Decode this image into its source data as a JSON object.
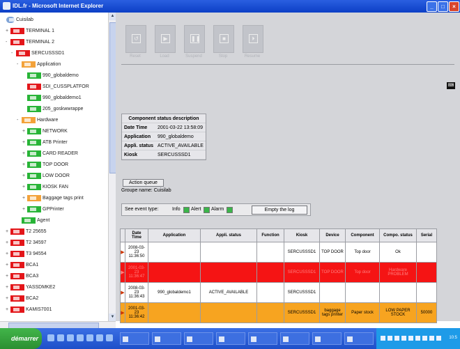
{
  "window": {
    "title": "IDL.fr - Microsoft Internet Explorer"
  },
  "tree": {
    "nodes": [
      {
        "label": "Cuisilab",
        "color": "root",
        "expander": ""
      },
      {
        "label": "TERMINAL 1",
        "color": "red",
        "expander": "+"
      },
      {
        "label": "TERMINAL 2",
        "color": "red",
        "expander": "-"
      },
      {
        "label": "SERCUSSSD1",
        "color": "red",
        "expander": "-"
      },
      {
        "label": "Application",
        "color": "orange",
        "expander": "-"
      },
      {
        "label": "990_globaldemo",
        "color": "green",
        "expander": ""
      },
      {
        "label": "SDI_CUSSPLATFOR",
        "color": "red",
        "expander": ""
      },
      {
        "label": "990_globaldemo1",
        "color": "green",
        "expander": ""
      },
      {
        "label": "205_goskwwrappe",
        "color": "green",
        "expander": ""
      },
      {
        "label": "Hardware",
        "color": "orange",
        "expander": "-"
      },
      {
        "label": "NETWORK",
        "color": "green",
        "expander": "+"
      },
      {
        "label": "ATB Printer",
        "color": "green",
        "expander": "+"
      },
      {
        "label": "CARD READER",
        "color": "green",
        "expander": "+"
      },
      {
        "label": "TOP DOOR",
        "color": "green",
        "expander": "+"
      },
      {
        "label": "LOW DOOR",
        "color": "green",
        "expander": "+"
      },
      {
        "label": "KIOSK FAN",
        "color": "green",
        "expander": "+"
      },
      {
        "label": "Baggage tags print",
        "color": "orange",
        "expander": "+"
      },
      {
        "label": "GPPrinter",
        "color": "green",
        "expander": "+"
      },
      {
        "label": "Agent",
        "color": "green",
        "expander": ""
      },
      {
        "label": "T2 25655",
        "color": "red",
        "expander": "+"
      },
      {
        "label": "T2 34597",
        "color": "red",
        "expander": "+"
      },
      {
        "label": "T3 94554",
        "color": "red",
        "expander": "+"
      },
      {
        "label": "BCA1",
        "color": "red",
        "expander": "+"
      },
      {
        "label": "BCA3",
        "color": "red",
        "expander": "+"
      },
      {
        "label": "YASSDMKE2",
        "color": "red",
        "expander": "+"
      },
      {
        "label": "BCA2",
        "color": "red",
        "expander": "+"
      },
      {
        "label": "KAMIS7001",
        "color": "red",
        "expander": "+"
      }
    ]
  },
  "toolbar": {
    "buttons": [
      {
        "label": "Reset",
        "icon": "reset-icon"
      },
      {
        "label": "Load",
        "icon": "play-icon"
      },
      {
        "label": "Suspend",
        "icon": "pause-icon"
      },
      {
        "label": "Stop",
        "icon": "stop-icon"
      },
      {
        "label": "Resume",
        "icon": "resume-icon"
      }
    ]
  },
  "component": {
    "heading": "Component status description",
    "rows": [
      {
        "key": "Date Time",
        "value": "2001-03-22 13:58:09"
      },
      {
        "key": "Application",
        "value": "990_globaldemo"
      },
      {
        "key": "Appli. status",
        "value": "ACTIVE_AVAILABLE"
      },
      {
        "key": "Kiosk",
        "value": "SERCUSSSD1"
      }
    ]
  },
  "queue": {
    "action_button": "Action queue",
    "group_name": "Groupe name: Cuisilab",
    "event_label": "See event type:",
    "info": "Info",
    "alert": "Alert",
    "alarm": "Alarm",
    "empty_log": "Empty the log"
  },
  "grid": {
    "headers": [
      "Date Time",
      "Application",
      "Appli. status",
      "Function",
      "Kiosk",
      "Device",
      "Component",
      "Compo. status",
      "Serial"
    ],
    "rows": [
      {
        "color": "white",
        "cells": [
          "2008-03-23 11:36:50",
          "",
          "",
          "",
          "SERCUSSSD1",
          "TOP DOOR",
          "Top door",
          "Ok",
          ""
        ]
      },
      {
        "color": "red",
        "cells": [
          "2001-03-23 11:36:47",
          "",
          "",
          "",
          "SERCUSSSD1",
          "TOP DOOR",
          "Top door",
          "Hardware PROBLEM",
          ""
        ]
      },
      {
        "color": "white",
        "cells": [
          "2008-03-23 11:36:43",
          "990_globaldemo1",
          "ACTIVE_AVAILABLE",
          "",
          "SERCUSSSD1",
          "",
          "",
          "",
          ""
        ]
      },
      {
        "color": "orange",
        "cells": [
          "2001-03-23 11:36:42",
          "",
          "",
          "",
          "SERCUSSSD1",
          "baggage tags printer",
          "Paper stock",
          "LOW PAPER STOCK",
          "50000"
        ]
      }
    ]
  },
  "taskbar": {
    "start": "démarrer",
    "tasks": [
      "",
      "",
      "",
      "",
      "",
      "",
      "",
      ""
    ],
    "clock": "10:5"
  }
}
